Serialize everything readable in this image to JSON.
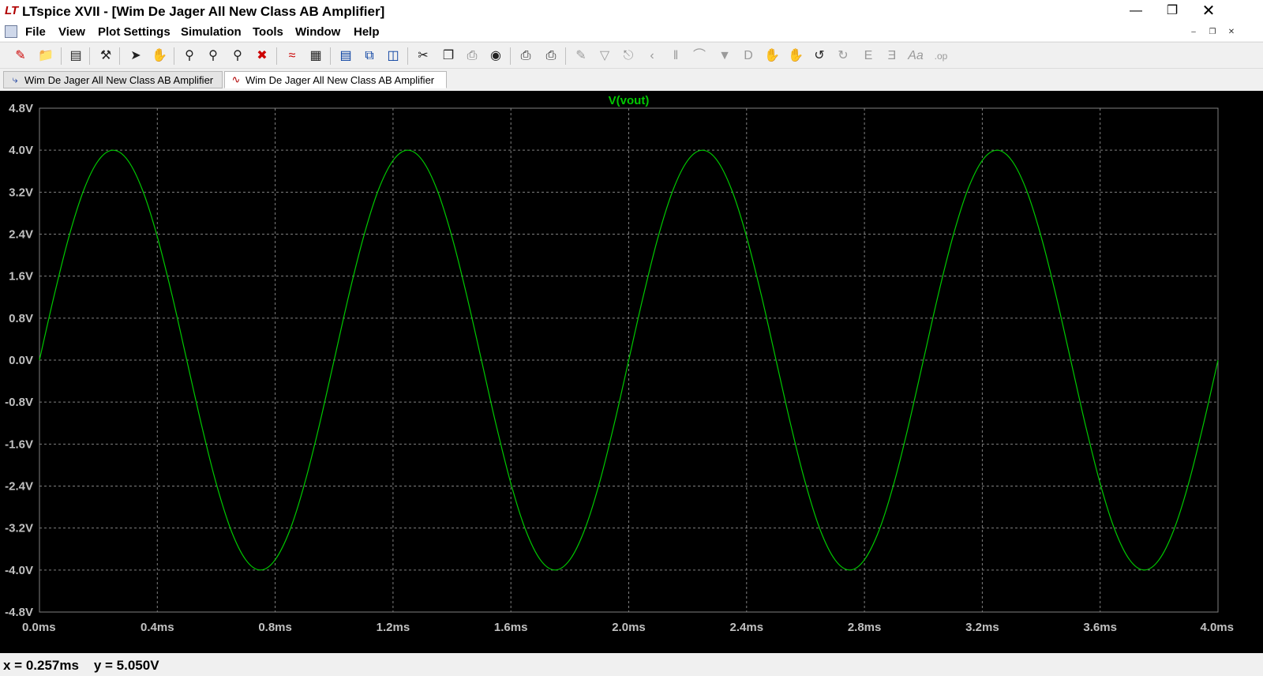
{
  "window": {
    "title": "LTspice XVII - [Wim De Jager All New Class AB Amplifier]",
    "logo": "LT",
    "controls": [
      "minimize",
      "maximize",
      "close"
    ]
  },
  "menu": {
    "items": [
      "File",
      "View",
      "Plot Settings",
      "Simulation",
      "Tools",
      "Window",
      "Help"
    ]
  },
  "toolbar": {
    "icons": [
      "new-schematic-icon",
      "open-folder-icon",
      "save-icon",
      "control-panel-icon",
      "run-icon",
      "halt-icon",
      "zoom-area-icon",
      "zoom-in-icon",
      "zoom-out-icon",
      "zoom-fit-icon",
      "autorange-icon",
      "grid-icon",
      "tile-horizontal-icon",
      "cascade-icon",
      "tile-vertical-icon",
      "cut-icon",
      "copy-icon",
      "paste-icon",
      "find-icon",
      "print-icon",
      "print-setup-icon",
      "wire-icon",
      "ground-icon",
      "label-icon",
      "resistor-icon",
      "capacitor-icon",
      "inductor-icon",
      "diode-icon",
      "component-icon",
      "move-icon",
      "drag-icon",
      "undo-icon",
      "redo-icon",
      "rotate-icon",
      "mirror-icon",
      "text-icon",
      "spice-directive-icon"
    ]
  },
  "tabs": [
    {
      "label": "Wim De Jager All New Class AB Amplifier",
      "icon": "schematic-icon",
      "active": false
    },
    {
      "label": "Wim De Jager All New Class AB Amplifier",
      "icon": "waveform-icon",
      "active": true
    }
  ],
  "chart_data": {
    "type": "line",
    "title": "V(vout)",
    "xlabel": "",
    "ylabel": "",
    "xlim": [
      0.0,
      4.0
    ],
    "ylim": [
      -4.8,
      4.8
    ],
    "x_unit": "ms",
    "y_unit": "V",
    "x_ticks": [
      "0.0ms",
      "0.4ms",
      "0.8ms",
      "1.2ms",
      "1.6ms",
      "2.0ms",
      "2.4ms",
      "2.8ms",
      "3.2ms",
      "3.6ms",
      "4.0ms"
    ],
    "y_ticks": [
      "4.8V",
      "4.0V",
      "3.2V",
      "2.4V",
      "1.6V",
      "0.8V",
      "0.0V",
      "-0.8V",
      "-1.6V",
      "-2.4V",
      "-3.2V",
      "-4.0V",
      "-4.8V"
    ],
    "grid": true,
    "background": "#000000",
    "grid_color": "#808080",
    "series": [
      {
        "name": "V(vout)",
        "color": "#00c800",
        "x": [
          0.0,
          0.05,
          0.1,
          0.15,
          0.2,
          0.25,
          0.3,
          0.35,
          0.4,
          0.45,
          0.5,
          0.55,
          0.6,
          0.65,
          0.7,
          0.75,
          0.8,
          0.85,
          0.9,
          0.95,
          1.0,
          1.05,
          1.1,
          1.15,
          1.2,
          1.25,
          1.3,
          1.35,
          1.4,
          1.45,
          1.5,
          1.55,
          1.6,
          1.65,
          1.7,
          1.75,
          1.8,
          1.85,
          1.9,
          1.95,
          2.0,
          2.05,
          2.1,
          2.15,
          2.2,
          2.25,
          2.3,
          2.35,
          2.4,
          2.45,
          2.5,
          2.55,
          2.6,
          2.65,
          2.7,
          2.75,
          2.8,
          2.85,
          2.9,
          2.95,
          3.0,
          3.05,
          3.1,
          3.15,
          3.2,
          3.25,
          3.3,
          3.35,
          3.4,
          3.45,
          3.5,
          3.55,
          3.6,
          3.65,
          3.7,
          3.75,
          3.8,
          3.85,
          3.9,
          3.95,
          4.0
        ],
        "y": [
          0.0,
          1.236,
          2.351,
          3.236,
          3.804,
          4.0,
          3.804,
          3.236,
          2.351,
          1.236,
          0.0,
          -1.236,
          -2.351,
          -3.236,
          -3.804,
          -4.0,
          -3.804,
          -3.236,
          -2.351,
          -1.236,
          0.0,
          1.236,
          2.351,
          3.236,
          3.804,
          4.0,
          3.804,
          3.236,
          2.351,
          1.236,
          0.0,
          -1.236,
          -2.351,
          -3.236,
          -3.804,
          -4.0,
          -3.804,
          -3.236,
          -2.351,
          -1.236,
          0.0,
          1.236,
          2.351,
          3.236,
          3.804,
          4.0,
          3.804,
          3.236,
          2.351,
          1.236,
          0.0,
          -1.236,
          -2.351,
          -3.236,
          -3.804,
          -4.0,
          -3.804,
          -3.236,
          -2.351,
          -1.236,
          0.0,
          1.236,
          2.351,
          3.236,
          3.804,
          4.0,
          3.804,
          3.236,
          2.351,
          1.236,
          0.0,
          -1.236,
          -2.351,
          -3.236,
          -3.804,
          -4.0,
          -3.804,
          -3.236,
          -2.351,
          -1.236,
          0.0
        ]
      }
    ]
  },
  "status": {
    "readout": "x = 0.257ms    y = 5.050V"
  }
}
